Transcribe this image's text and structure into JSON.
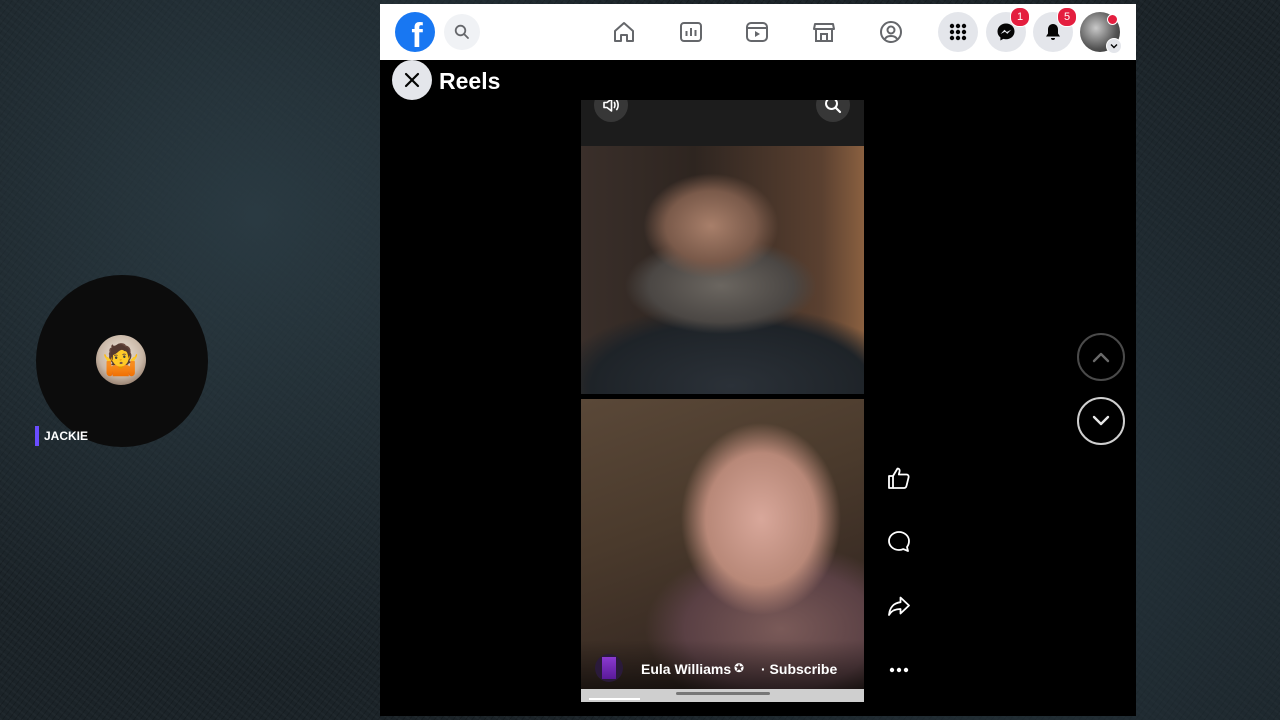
{
  "topbar": {
    "brand_letter": "f",
    "messenger_badge": "1",
    "notifications_badge": "5",
    "icons": [
      "home-icon",
      "chart-icon",
      "reels-icon",
      "marketplace-icon",
      "groups-icon",
      "menu-grid-icon",
      "messenger-icon",
      "bell-icon"
    ]
  },
  "reels": {
    "title": "Reels"
  },
  "video": {
    "channel_name": "Eula Williams",
    "verified_glyph": "✪",
    "subscribe_label": "· Subscribe",
    "progress": 0.18
  },
  "overlay": {
    "streamer_label": "JACKIE",
    "avatar_emoji": "🤷"
  },
  "colors": {
    "brand": "#1877f2",
    "badge": "#e41e3f",
    "label_accent": "#6a4cff"
  }
}
